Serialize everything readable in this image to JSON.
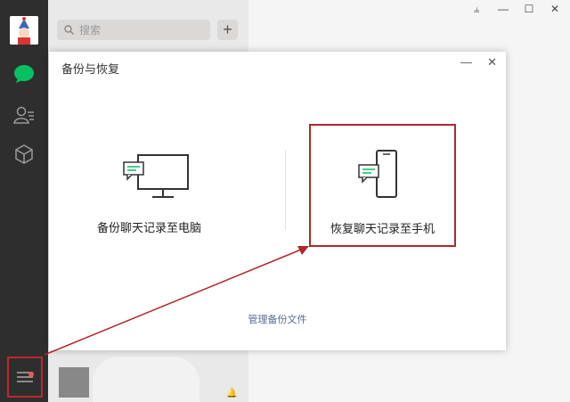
{
  "search": {
    "placeholder": "搜索"
  },
  "dialog": {
    "title": "备份与恢复",
    "backup_label": "备份聊天记录至电脑",
    "restore_label": "恢复聊天记录至手机",
    "manage_label": "管理备份文件"
  },
  "window": {
    "pin": "⫨",
    "minimize": "—",
    "maximize": "☐",
    "close": "✕"
  },
  "colors": {
    "sidebar": "#2e2e2e",
    "accent_green": "#07c160",
    "highlight_red": "#b1282c",
    "link": "#576b95"
  },
  "icons": [
    "chat-icon",
    "contacts-icon",
    "cube-icon",
    "menu-icon",
    "search-icon",
    "plus-icon",
    "monitor-icon",
    "phone-icon"
  ]
}
